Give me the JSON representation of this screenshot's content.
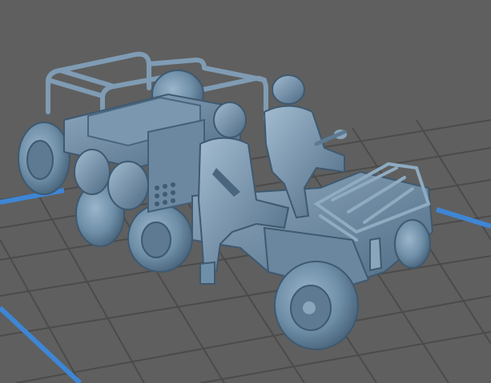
{
  "scene": {
    "subject_icon": "atv-with-two-soldiers-icon",
    "colors": {
      "background": "#5f5f5f",
      "grid_line": "#4b4b4b",
      "grid_cell": "#5a5a5a",
      "plate_edge": "#3e86d6",
      "model_base": "#6f8fa8",
      "model_dark": "#46637b",
      "model_light": "#9ab5cb"
    }
  }
}
